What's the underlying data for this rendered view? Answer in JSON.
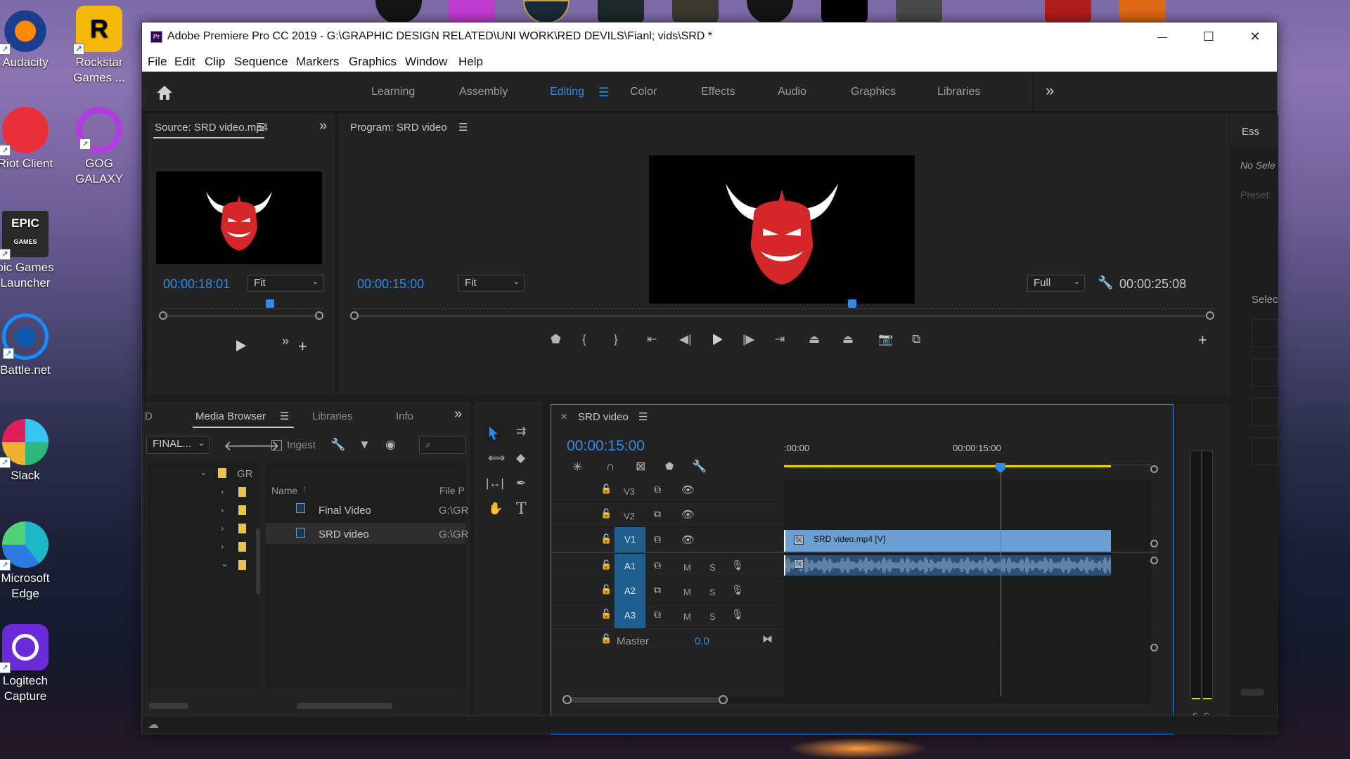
{
  "desktop": {
    "icons": [
      {
        "label": "Audacity"
      },
      {
        "label": "Rockstar Games ..."
      },
      {
        "label": "Riot Client"
      },
      {
        "label": "GOG GALAXY"
      },
      {
        "label": "pic Games Launcher"
      },
      {
        "label": "Battle.net"
      },
      {
        "label": "Slack"
      },
      {
        "label": "Microsoft Edge"
      },
      {
        "label": "Logitech Capture"
      }
    ]
  },
  "window": {
    "title": "Adobe Premiere Pro CC 2019 - G:\\GRAPHIC DESIGN RELATED\\UNI WORK\\RED DEVILS\\Fianl; vids\\SRD *",
    "app_badge": "Pr",
    "controls": {
      "minimize": "—",
      "maximize": "☐",
      "close": "✕"
    }
  },
  "menu": [
    "File",
    "Edit",
    "Clip",
    "Sequence",
    "Markers",
    "Graphics",
    "Window",
    "Help"
  ],
  "workspaces": {
    "tabs": [
      "Learning",
      "Assembly",
      "Editing",
      "Color",
      "Effects",
      "Audio",
      "Graphics",
      "Libraries"
    ],
    "active": "Editing",
    "more": "»"
  },
  "source_monitor": {
    "title": "Source: SRD video.mp4",
    "timecode": "00:00:18:01",
    "fit": "Fit",
    "more": "»"
  },
  "program_monitor": {
    "title": "Program: SRD video",
    "timecode": "00:00:15:00",
    "fit": "Fit",
    "resolution": "Full",
    "duration": "00:00:25:08"
  },
  "essential_panel": {
    "title": "Ess",
    "no_selection": "No Sele",
    "preset": "Preset:",
    "select": "Selec"
  },
  "project_panel": {
    "tabs": [
      "D",
      "Media Browser",
      "Libraries",
      "Info"
    ],
    "active_tab": "Media Browser",
    "path_dropdown": "FINAL...",
    "ingest_label": "Ingest",
    "tree_root": "GR",
    "columns": {
      "name": "Name",
      "path": "File P"
    },
    "files": [
      {
        "name": "Final Video",
        "path": "G:\\GR"
      },
      {
        "name": "SRD video",
        "path": "G:\\GR"
      }
    ]
  },
  "timeline": {
    "sequence_name": "SRD video",
    "timecode": "00:00:15:00",
    "ruler_start": ":00:00",
    "ruler_mark": "00:00:15:00",
    "video_tracks": [
      "V3",
      "V2",
      "V1"
    ],
    "audio_tracks": [
      "A1",
      "A2",
      "A3"
    ],
    "master_label": "Master",
    "master_value": "0.0",
    "clip_label": "SRD video.mp4 [V]",
    "fx_badge": "fx",
    "mute": "M",
    "solo": "S",
    "playhead_fraction": 0.59,
    "clip_end_fraction": 0.99
  },
  "audio_meter": {
    "solo_labels": [
      "S",
      "S"
    ]
  },
  "colors": {
    "accent_blue": "#2d8ceb",
    "clip_blue": "#6b9fd3",
    "work_area_yellow": "#e6d600",
    "devil_red": "#d5262a"
  }
}
